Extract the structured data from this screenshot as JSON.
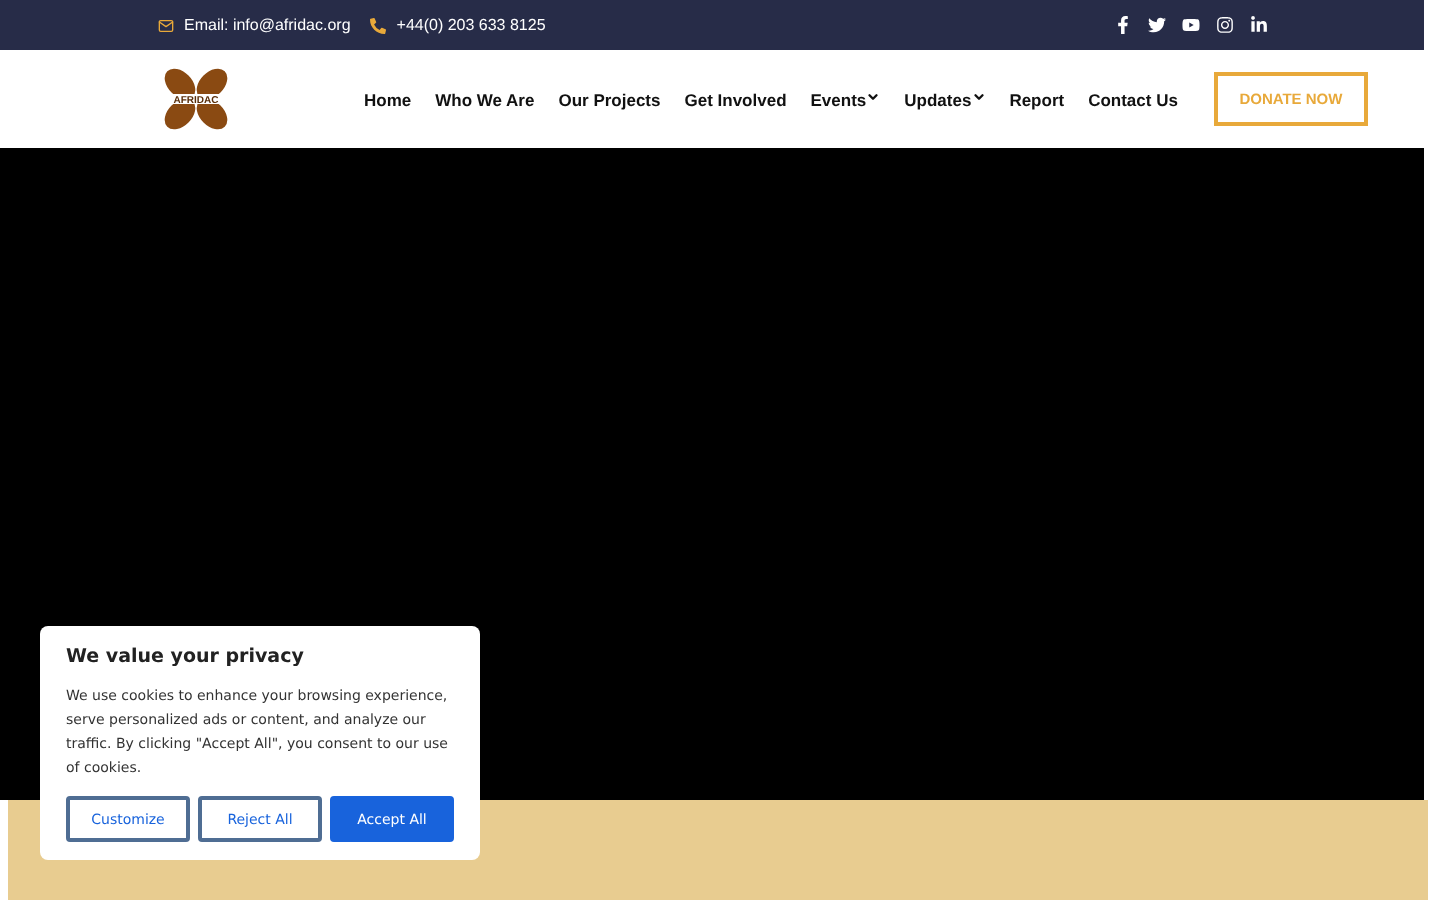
{
  "topbar": {
    "email": "Email: info@afridac.org",
    "phone": "+44(0) 203 633 8125",
    "social": [
      {
        "kind": "facebook"
      },
      {
        "kind": "twitter"
      },
      {
        "kind": "youtube"
      },
      {
        "kind": "instagram"
      },
      {
        "kind": "linkedin"
      }
    ]
  },
  "header": {
    "logo_text": "AFRIDAC",
    "nav": [
      {
        "label": "Home",
        "dropdown": false
      },
      {
        "label": "Who We Are",
        "dropdown": false
      },
      {
        "label": "Our Projects",
        "dropdown": false
      },
      {
        "label": "Get Involved",
        "dropdown": false
      },
      {
        "label": "Events",
        "dropdown": true
      },
      {
        "label": "Updates",
        "dropdown": true
      },
      {
        "label": "Report",
        "dropdown": false
      },
      {
        "label": "Contact Us",
        "dropdown": false
      }
    ],
    "donate": "DONATE NOW"
  },
  "cookie_banner": {
    "title": "We value your privacy",
    "text": "We use cookies to enhance your browsing experience, serve personalized ads or content, and analyze our traffic. By clicking \"Accept All\", you consent to our use of cookies.",
    "buttons": [
      {
        "label": "Customize",
        "primary": false
      },
      {
        "label": "Reject All",
        "primary": false
      },
      {
        "label": "Accept All",
        "primary": true
      }
    ]
  }
}
